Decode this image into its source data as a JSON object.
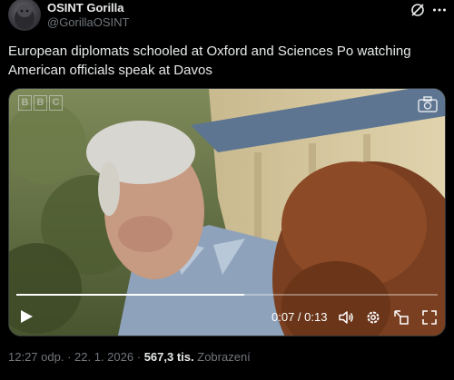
{
  "author": {
    "display_name": "OSINT Gorilla",
    "handle": "@GorillaOSINT"
  },
  "tweet": {
    "text": "European diplomats schooled at Oxford and Sciences Po watching American officials speak at Davos"
  },
  "video": {
    "watermark": [
      "B",
      "B",
      "C"
    ],
    "time_display": "0:07 / 0:13",
    "progress_fraction": 0.54
  },
  "footer": {
    "time": "12:27 odp.",
    "separator": "·",
    "date": "22. 1. 2026",
    "views_count": "567,3 tis.",
    "views_label": "Zobrazení"
  },
  "icons": {
    "header": [
      "grok-icon",
      "more-icon"
    ],
    "media": [
      "camera-icon"
    ],
    "controls": [
      "play-icon",
      "volume-icon",
      "settings-icon",
      "pop-out-icon",
      "fullscreen-icon"
    ]
  }
}
